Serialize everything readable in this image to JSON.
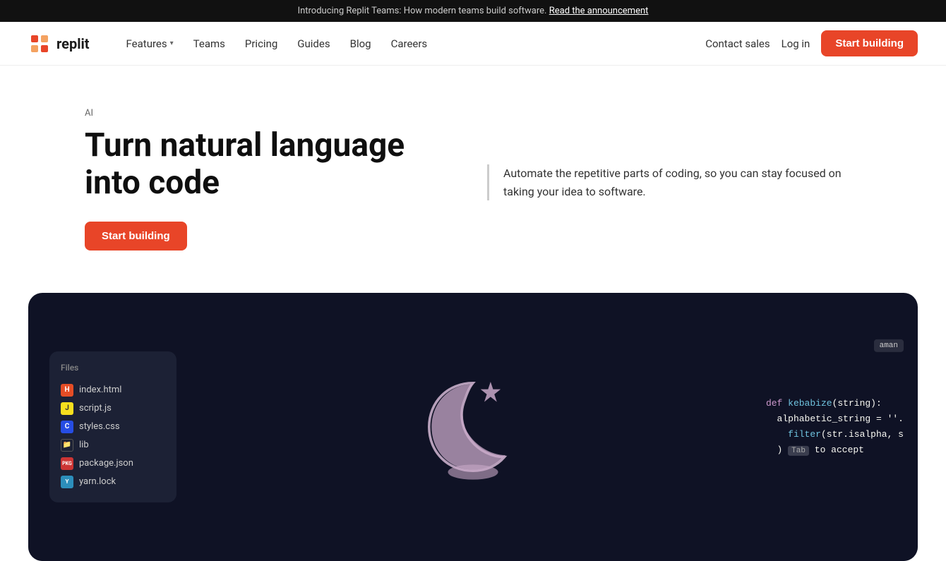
{
  "announcement": {
    "text": "Introducing Replit Teams: How modern teams build software.",
    "link_text": "Read the announcement"
  },
  "nav": {
    "logo_text": "replit",
    "features_label": "Features",
    "teams_label": "Teams",
    "pricing_label": "Pricing",
    "guides_label": "Guides",
    "blog_label": "Blog",
    "careers_label": "Careers",
    "contact_sales_label": "Contact sales",
    "login_label": "Log in",
    "start_building_label": "Start building"
  },
  "hero": {
    "tag": "AI",
    "title": "Turn natural language into code",
    "cta_label": "Start building",
    "description": "Automate the repetitive parts of coding, so you can stay focused on taking your idea to software."
  },
  "demo": {
    "files_title": "Files",
    "files": [
      {
        "name": "index.html",
        "type": "html"
      },
      {
        "name": "script.js",
        "type": "js"
      },
      {
        "name": "styles.css",
        "type": "css"
      },
      {
        "name": "lib",
        "type": "folder"
      },
      {
        "name": "package.json",
        "type": "pkg"
      },
      {
        "name": "yarn.lock",
        "type": "yarn"
      }
    ],
    "code_user": "aman",
    "code_lines": [
      "def kebabize(string):",
      "  alphabetic_string = ''.",
      "    filter(str.isalpha, s",
      "  ) Tab to accept"
    ]
  },
  "colors": {
    "accent": "#e84528",
    "dark_bg": "#0f1225"
  }
}
